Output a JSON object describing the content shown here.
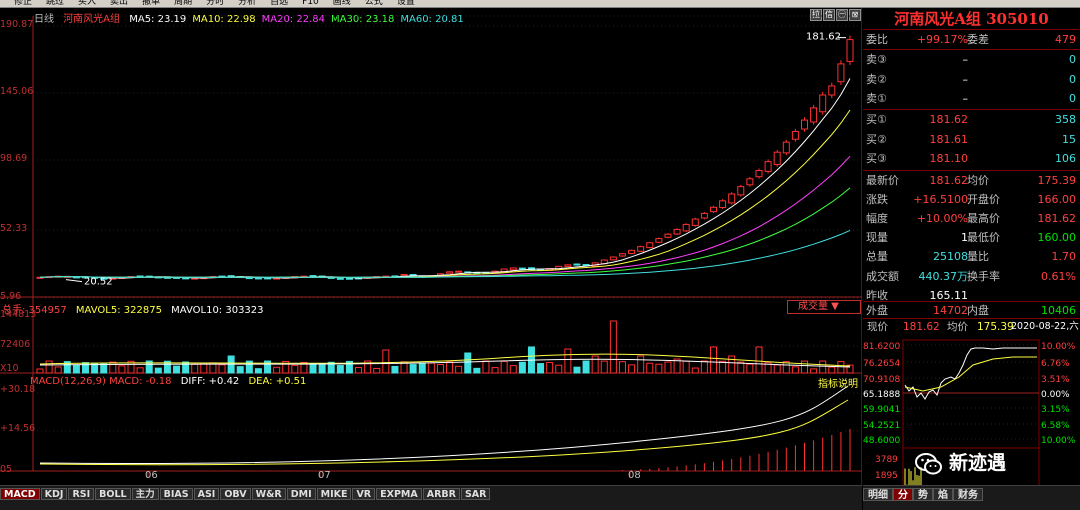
{
  "toolbar": [
    "修正",
    "跳过",
    "买入",
    "卖出",
    "撤单",
    "周期",
    "分时",
    "分析",
    "自选",
    "F10",
    "画线",
    "公式",
    "设置"
  ],
  "kline": {
    "period_label": "日线",
    "stock_name": "河南风光A组",
    "ma": [
      {
        "label": "MA5: 23.19",
        "color": "#ffffff"
      },
      {
        "label": "MA10: 22.98",
        "color": "#ffff40"
      },
      {
        "label": "MA20: 22.84",
        "color": "#ff40ff"
      },
      {
        "label": "MA30: 23.18",
        "color": "#40ff40"
      },
      {
        "label": "MA60: 20.81",
        "color": "#40e0e0"
      }
    ],
    "y_ticks": [
      "190.87",
      "145.06",
      "98.69",
      "52.33",
      "5.96"
    ],
    "high_label": "181.62",
    "low_label": "20.52",
    "x_labels": [
      "05",
      "06",
      "07",
      "08"
    ]
  },
  "volume": {
    "labels": [
      "总手: 354957",
      "MAVOL5: 322875",
      "MAVOL10: 303323"
    ],
    "y_ticks": [
      "144813",
      "72406",
      "X10"
    ],
    "dropdown": "成交量 ▼"
  },
  "macd": {
    "labels": [
      "MACD(12,26,9) MACD: -0.18",
      "DIFF: +0.42",
      "DEA: +0.51"
    ],
    "y_ticks": [
      "+30.18",
      "+14.56",
      "05"
    ],
    "explain": "指标说明"
  },
  "bottom_tabs": [
    "MACD",
    "KDJ",
    "RSI",
    "BOLL",
    "主力",
    "BIAS",
    "ASI",
    "OBV",
    "W&R",
    "DMI",
    "MIKE",
    "VR",
    "EXPMA",
    "ARBR",
    "SAR"
  ],
  "corner_buttons": [
    "拉",
    "信",
    "㊀",
    "⊠"
  ],
  "quote": {
    "title": "河南风光A组 305010",
    "weibi_label": "委比",
    "weibi": "+99.17%",
    "weicha_label": "委差",
    "weicha": "479",
    "sell": [
      {
        "label": "卖③",
        "price": "–",
        "vol": "0"
      },
      {
        "label": "卖②",
        "price": "–",
        "vol": "0"
      },
      {
        "label": "卖①",
        "price": "–",
        "vol": "0"
      }
    ],
    "buy": [
      {
        "label": "买①",
        "price": "181.62",
        "vol": "358"
      },
      {
        "label": "买②",
        "price": "181.61",
        "vol": "15"
      },
      {
        "label": "买③",
        "price": "181.10",
        "vol": "106"
      }
    ],
    "stats": [
      {
        "l1": "最新价",
        "v1": "181.62",
        "l2": "均价",
        "v2": "175.39"
      },
      {
        "l1": "涨跌",
        "v1": "+16.5100",
        "l2": "开盘价",
        "v2": "166.00"
      },
      {
        "l1": "幅度",
        "v1": "+10.00%",
        "l2": "最高价",
        "v2": "181.62"
      },
      {
        "l1": "现量",
        "v1": "1",
        "l2": "最低价",
        "v2": "160.00"
      },
      {
        "l1": "总量",
        "v1": "25108",
        "l2": "量比",
        "v2": "1.70"
      },
      {
        "l1": "成交额",
        "v1": "440.37万",
        "l2": "换手率",
        "v2": "0.61%"
      },
      {
        "l1": "昨收",
        "v1": "165.11",
        "l2": "",
        "v2": ""
      }
    ],
    "outer_label": "外盘",
    "outer": "14702",
    "inner_label": "内盘",
    "inner": "10406"
  },
  "intraday": {
    "now_label": "现价",
    "now": "181.62",
    "avg_label": "均价",
    "avg": "175.39",
    "date": "2020-08-22,六",
    "left_ticks": [
      "81.6200",
      "76.2654",
      "70.9108",
      "65.1888",
      "59.9041",
      "54.2521",
      "48.6000"
    ],
    "right_ticks": [
      "10.00%",
      "6.76%",
      "3.51%",
      "0.00%",
      "3.15%",
      "6.58%",
      "10.00%"
    ],
    "vol_ticks": [
      "3789",
      "1895"
    ]
  },
  "right_tabs": [
    "明细",
    "分",
    "势",
    "焰",
    "财务"
  ],
  "watermark": "新迹遇"
}
